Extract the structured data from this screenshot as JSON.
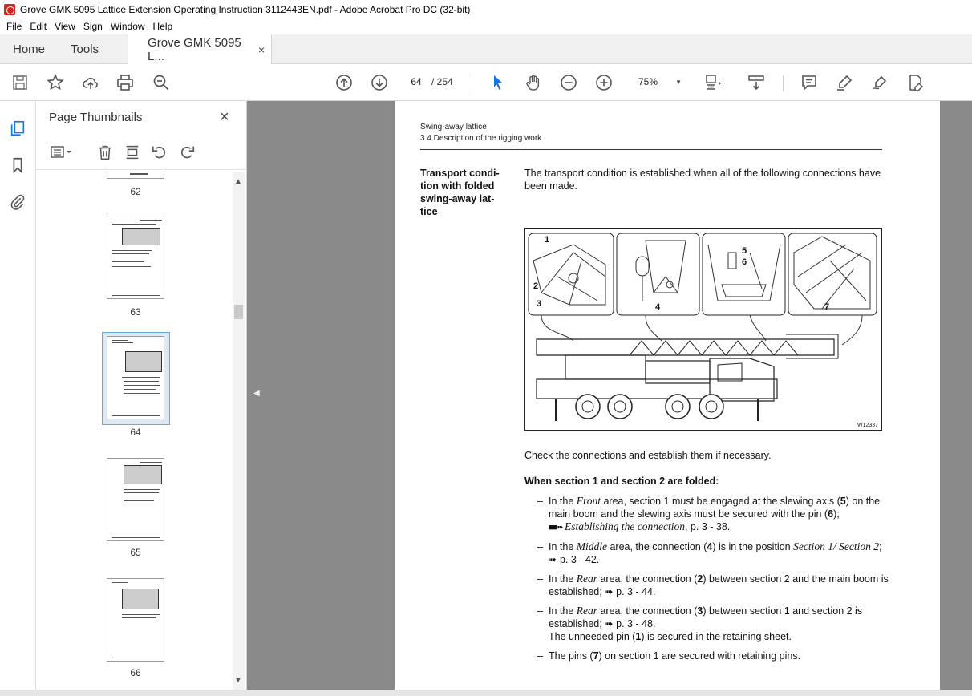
{
  "window": {
    "title": "Grove GMK 5095 Lattice Extension Operating Instruction  3112443EN.pdf - Adobe Acrobat Pro DC (32-bit)"
  },
  "menu": [
    "File",
    "Edit",
    "View",
    "Sign",
    "Window",
    "Help"
  ],
  "tabs": {
    "home": "Home",
    "tools": "Tools",
    "doc": "Grove GMK 5095 L...",
    "doc_close": "×"
  },
  "toolbar": {
    "page_current": "64",
    "page_total": "/  254",
    "zoom": "75%"
  },
  "panel": {
    "title": "Page Thumbnails",
    "close": "×",
    "thumbs": [
      "62",
      "63",
      "64",
      "65",
      "66"
    ],
    "selected": "64"
  },
  "page": {
    "header_line1": "Swing-away lattice",
    "header_line2": "3.4 Description of the rigging work",
    "side_heading": "Transport condi-tion with folded swing-away lat-tice",
    "intro": "The transport condition is established when all of the following connections have been made.",
    "figure": {
      "id": "W12337",
      "labels": [
        "1",
        "2",
        "3",
        "4",
        "5",
        "6",
        "7"
      ]
    },
    "check": "Check the connections and establish them if necessary.",
    "subheading": "When section 1 and section 2 are folded:",
    "bullets": [
      {
        "pre": "In the ",
        "area": "Front",
        "mid": " area, section 1 must be engaged at the slewing axis (",
        "n1": "5",
        "mid2": ") on the main boom and the slewing axis must be secured with the pin (",
        "n2": "6",
        "post": ");",
        "link": "Establishing the connection",
        "page": ", p. 3 - 38."
      },
      {
        "pre": "In the ",
        "area": "Middle",
        "mid": " area, the connection (",
        "n1": "4",
        "mid2": ") is in the position ",
        "link": "Section 1/ Section 2",
        "page": "; ➠ p. 3 - 42."
      },
      {
        "pre": "In the ",
        "area": "Rear",
        "mid": " area, the connection (",
        "n1": "2",
        "mid2": ") between section 2 and the main boom is established;",
        "page": " ➠ p. 3 - 44."
      },
      {
        "pre": "In the ",
        "area": "Rear",
        "mid": " area, the connection (",
        "n1": "3",
        "mid2": ") between section 1 and section 2 is established;",
        "page": " ➠ p. 3 - 48.",
        "extra_pre": "The unneeded pin (",
        "extra_n": "1",
        "extra_post": ") is secured in the retaining sheet."
      },
      {
        "pre": "The pins (",
        "n1": "7",
        "mid2": ") on section 1 are secured with retaining pins."
      }
    ]
  }
}
